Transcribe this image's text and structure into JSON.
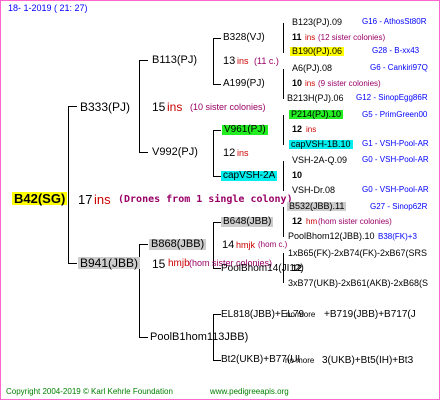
{
  "header": {
    "date": "18-  1-2019  ( 21: 27)"
  },
  "root": {
    "name": "B42(SG)",
    "num": "17",
    "ins": "ins",
    "note": "(Drones from 1 single colony)"
  },
  "gen1": [
    {
      "name": "B333(PJ)",
      "num": "15",
      "ins": "ins",
      "note": "(10 sister colonies)"
    },
    {
      "name": "B941(JBB)",
      "num": "15",
      "ins": "hmjb",
      "note": "(hom sister colonies)"
    }
  ],
  "gen2": [
    {
      "name": "B113(PJ)",
      "num": "13",
      "ins": "ins",
      "note": "(11 c.)"
    },
    {
      "name": "V992(PJ)",
      "num": "12",
      "ins": "ins"
    },
    {
      "name": "B868(JBB)",
      "num": "14",
      "ins": "hmjk",
      "note": "(hom c.)"
    },
    {
      "name": "PoolB1hom113JBB)"
    }
  ],
  "gen3": [
    {
      "name": "B328(VJ)"
    },
    {
      "name": "A199(PJ)"
    },
    {
      "name": "V961(PJ)"
    },
    {
      "name": "capVSH-2A"
    },
    {
      "name": "B648(JBB)"
    },
    {
      "name": "PoolBhom14(JI12)"
    },
    {
      "name": "EL818(JBB)+EL79"
    },
    {
      "name": "Bt2(UKB)+B77(UI"
    }
  ],
  "gen4": [
    {
      "name": "B123(PJ).09",
      "tag": "G16 - AthosSt80R"
    },
    {
      "num": "11",
      "ins": "ins",
      "note": "(12 sister colonies)"
    },
    {
      "name": "B190(PJ).06",
      "tag": "G28 - B-xx43"
    },
    {
      "name": "A6(PJ).08",
      "tag": "G6 - Cankiri97Q"
    },
    {
      "num": "10",
      "ins": "ins",
      "note": "(9 sister colonies)"
    },
    {
      "name": "B213H(PJ).06",
      "tag": "G12 - SinopEgg86R"
    },
    {
      "name": "P214(PJ).10",
      "tag": "G5 - PrimGreen00"
    },
    {
      "num": "12",
      "ins": "ins"
    },
    {
      "name": "capVSH-1B.10",
      "tag": "G1 - VSH-Pool-AR"
    },
    {
      "name": "VSH-2A-Q.09",
      "tag": "G0 - VSH-Pool-AR"
    },
    {
      "num": "10"
    },
    {
      "name": "VSH-Dr.08",
      "tag": "G0 - VSH-Pool-AR"
    },
    {
      "name": "B532(JBB).11",
      "tag": "G27 - Sinop62R"
    },
    {
      "num": "12",
      "ins": "hm",
      "note": "(hom sister colonies)"
    },
    {
      "name": "PoolBhom12(JBB).10",
      "tag": "B38(FK)+3"
    },
    {
      "name": "1xB65(FK)-2xB74(FK)-2xB67(SRS"
    },
    {
      "num": "12"
    },
    {
      "name": "3xB77(UKB)-2xB61(AKB)-2xB68(S"
    },
    {
      "name": "no more"
    },
    {
      "name": "+B719(JBB)+B717(J"
    },
    {
      "name": "no more"
    },
    {
      "name": "3(UKB)+Bt5(IH)+Bt3"
    }
  ],
  "footer": {
    "copyright": "Copyright 2004-2019 © Karl Kehrle Foundation",
    "site": "www.pedigreeapis.org"
  }
}
